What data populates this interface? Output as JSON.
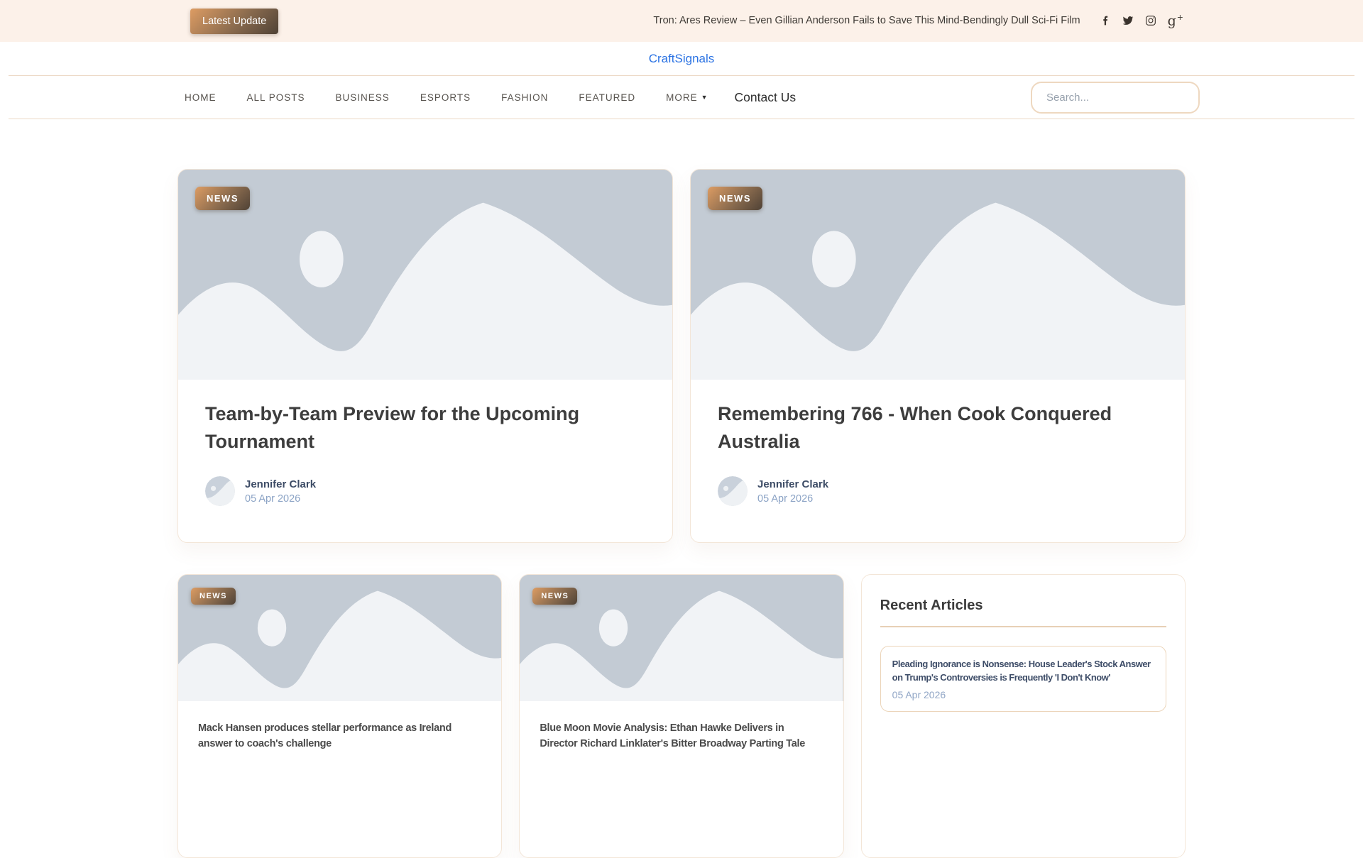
{
  "topbar": {
    "update_button": "Latest Update",
    "headline": "Tron: Ares Review – Even Gillian Anderson Fails to Save This Mind-Bendingly Dull Sci-Fi Film",
    "social_icons": [
      "facebook",
      "twitter",
      "instagram",
      "google-plus"
    ]
  },
  "header": {
    "site_title": "CraftSignals"
  },
  "nav": {
    "items": {
      "home": "HOME",
      "all_posts": "ALL POSTS",
      "business": "BUSINESS",
      "esports": "ESPORTS",
      "fashion": "FASHION",
      "featured": "FEATURED",
      "more": "MORE"
    },
    "contact": "Contact Us",
    "search_placeholder": "Search..."
  },
  "posts": {
    "featured": [
      {
        "badge": "NEWS",
        "title": "Team-by-Team Preview for the Upcoming Tournament",
        "author": "Jennifer Clark",
        "date": "05 Apr 2026"
      },
      {
        "badge": "NEWS",
        "title": "Remembering 766 - When Cook Conquered Australia",
        "author": "Jennifer Clark",
        "date": "05 Apr 2026"
      }
    ],
    "secondary": [
      {
        "badge": "NEWS",
        "title": "Mack Hansen produces stellar performance as Ireland answer to coach's challenge"
      },
      {
        "badge": "NEWS",
        "title": "Blue Moon Movie Analysis: Ethan Hawke Delivers in Director Richard Linklater's Bitter Broadway Parting Tale"
      }
    ]
  },
  "sidebar": {
    "title": "Recent Articles",
    "articles": [
      {
        "title": "Pleading Ignorance is Nonsense: House Leader's Stock Answer on Trump's Controversies is Frequently 'I Don't Know'",
        "date": "05 Apr 2026"
      }
    ]
  },
  "colors": {
    "topbar_bg": "#fcf1e9",
    "accent_gradient_start": "#dd9c63",
    "accent_gradient_end": "#4f4236",
    "brand_blue": "#2a72e3",
    "border_tan": "#ecd9c6",
    "image_placeholder_bg": "#c3cbd4",
    "image_placeholder_fg": "#f1f3f6",
    "meta_date_color": "#8ba3c5"
  }
}
